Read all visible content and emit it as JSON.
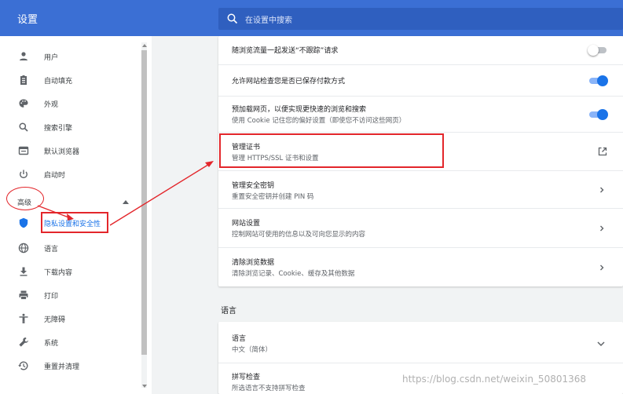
{
  "header": {
    "title": "设置",
    "search_placeholder": "在设置中搜索"
  },
  "sidebar": {
    "items": [
      {
        "label": "用户",
        "icon": "person-icon"
      },
      {
        "label": "自动填充",
        "icon": "clipboard-icon"
      },
      {
        "label": "外观",
        "icon": "palette-icon"
      },
      {
        "label": "搜索引擎",
        "icon": "search-icon"
      },
      {
        "label": "默认浏览器",
        "icon": "browser-icon"
      },
      {
        "label": "启动时",
        "icon": "power-icon"
      }
    ],
    "advanced_label": "高级",
    "advanced_items": [
      {
        "label": "隐私设置和安全性",
        "icon": "shield-icon",
        "active": true
      },
      {
        "label": "语言",
        "icon": "globe-icon"
      },
      {
        "label": "下载内容",
        "icon": "download-icon"
      },
      {
        "label": "打印",
        "icon": "printer-icon"
      },
      {
        "label": "无障碍",
        "icon": "accessibility-icon"
      },
      {
        "label": "系统",
        "icon": "wrench-icon"
      },
      {
        "label": "重置并清理",
        "icon": "restore-icon"
      }
    ]
  },
  "privacy": {
    "rows": [
      {
        "title": "随浏览流量一起发送“不跟踪”请求",
        "control": "toggle",
        "on": false
      },
      {
        "title": "允许网站检查您是否已保存付款方式",
        "control": "toggle",
        "on": true
      },
      {
        "title": "预加载网页，以便实现更快速的浏览和搜索",
        "subtitle": "使用 Cookie 记住您的偏好设置（即使您不访问这些网页）",
        "control": "toggle",
        "on": true
      },
      {
        "title": "管理证书",
        "subtitle": "管理 HTTPS/SSL 证书和设置",
        "control": "external"
      },
      {
        "title": "管理安全密钥",
        "subtitle": "重置安全密钥并创建 PIN 码",
        "control": "chevron"
      },
      {
        "title": "网站设置",
        "subtitle": "控制网站可使用的信息以及可向您显示的内容",
        "control": "chevron"
      },
      {
        "title": "清除浏览数据",
        "subtitle": "清除浏览记录、Cookie、缓存及其他数据",
        "control": "chevron"
      }
    ]
  },
  "language_section": {
    "title": "语言",
    "rows": [
      {
        "title": "语言",
        "subtitle": "中文（简体）"
      },
      {
        "title": "拼写检查",
        "subtitle": "所选语言不支持拼写检查"
      }
    ]
  },
  "watermark": "https://blog.csdn.net/weixin_50801368",
  "colors": {
    "header": "#3b6fd4",
    "accent": "#1a73e8",
    "annotation": "#e3262b"
  }
}
